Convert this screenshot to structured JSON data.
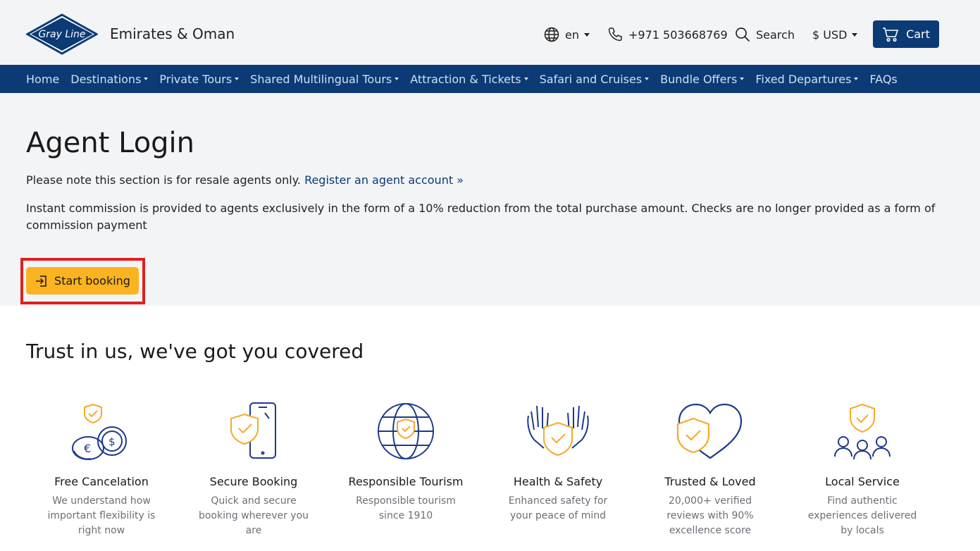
{
  "header": {
    "logo_text": "Gray Line",
    "brand": "Emirates & Oman",
    "language": "en",
    "phone": "+971 503668769",
    "search_label": "Search",
    "currency": "$ USD",
    "cart_label": "Cart"
  },
  "nav": {
    "items": [
      {
        "label": "Home",
        "dropdown": false
      },
      {
        "label": "Destinations",
        "dropdown": true
      },
      {
        "label": "Private Tours",
        "dropdown": true
      },
      {
        "label": "Shared Multilingual Tours",
        "dropdown": true
      },
      {
        "label": "Attraction & Tickets",
        "dropdown": true
      },
      {
        "label": "Safari and Cruises",
        "dropdown": true
      },
      {
        "label": "Bundle Offers",
        "dropdown": true
      },
      {
        "label": "Fixed Departures",
        "dropdown": true
      },
      {
        "label": "FAQs",
        "dropdown": false
      }
    ]
  },
  "login": {
    "title": "Agent Login",
    "note": "Please note this section is for resale agents only.",
    "register_link": "Register an agent account »",
    "commission": "Instant commission is provided to agents exclusively in the form of a 10% reduction from the total purchase amount. Checks are no longer provided as a form of commission payment",
    "start_label": "Start booking"
  },
  "trust": {
    "title": "Trust in us, we've got you covered",
    "features": [
      {
        "icon": "coins-shield-icon",
        "title": "Free Cancelation",
        "desc": "We understand how important flexibility is right now"
      },
      {
        "icon": "phone-shield-icon",
        "title": "Secure Booking",
        "desc": "Quick and secure booking wherever you are"
      },
      {
        "icon": "globe-shield-icon",
        "title": "Responsible Tourism",
        "desc": "Responsible tourism since 1910"
      },
      {
        "icon": "hands-shield-icon",
        "title": "Health & Safety",
        "desc": "Enhanced safety for your peace of mind"
      },
      {
        "icon": "heart-shield-icon",
        "title": "Trusted & Loved",
        "desc": "20,000+ verified reviews with 90% excellence score"
      },
      {
        "icon": "people-shield-icon",
        "title": "Local Service",
        "desc": "Find authentic experiences delivered by locals"
      }
    ]
  },
  "colors": {
    "navy": "#0b3a75",
    "accent": "#fbb321",
    "highlight": "#e0201e",
    "icon_orange": "#f7a928",
    "icon_navy": "#1e3a8a"
  }
}
